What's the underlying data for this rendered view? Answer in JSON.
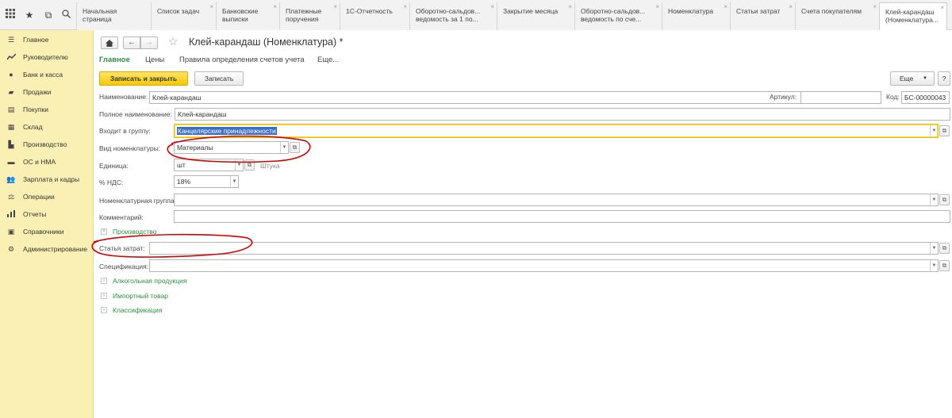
{
  "tabs": [
    {
      "label": "Начальная страница",
      "closable": false
    },
    {
      "label": "Список задач",
      "closable": true
    },
    {
      "label": "Банковские\nвыписки",
      "closable": true
    },
    {
      "label": "Платежные\nпоручения",
      "closable": true
    },
    {
      "label": "1С-Отчетность",
      "closable": true
    },
    {
      "label": "Оборотно-сальдов...\nведомость за 1 по...",
      "closable": true
    },
    {
      "label": "Закрытие месяца",
      "closable": true
    },
    {
      "label": "Оборотно-сальдов...\nведомость по сче...",
      "closable": true
    },
    {
      "label": "Номенклатура",
      "closable": true
    },
    {
      "label": "Статьи затрат",
      "closable": true
    },
    {
      "label": "Счета покупателям",
      "closable": true
    },
    {
      "label": "Клей-карандаш\n(Номенклатура...",
      "closable": true
    }
  ],
  "sidebar": {
    "items": [
      {
        "label": "Главное",
        "icon": "menu-lines-icon"
      },
      {
        "label": "Руководителю",
        "icon": "trend-chart-icon"
      },
      {
        "label": "Банк и касса",
        "icon": "coin-icon"
      },
      {
        "label": "Продажи",
        "icon": "cart-icon"
      },
      {
        "label": "Покупки",
        "icon": "basket-icon"
      },
      {
        "label": "Склад",
        "icon": "warehouse-icon"
      },
      {
        "label": "Производство",
        "icon": "factory-icon"
      },
      {
        "label": "ОС и НМА",
        "icon": "truck-icon"
      },
      {
        "label": "Зарплата и кадры",
        "icon": "people-icon"
      },
      {
        "label": "Операции",
        "icon": "operations-icon"
      },
      {
        "label": "Отчеты",
        "icon": "bar-chart-icon"
      },
      {
        "label": "Справочники",
        "icon": "book-icon"
      },
      {
        "label": "Администрирование",
        "icon": "gear-icon"
      }
    ]
  },
  "form": {
    "title": "Клей-карандаш (Номенклатура) *",
    "subtabs": [
      "Главное",
      "Цены",
      "Правила определения счетов учета",
      "Еще..."
    ],
    "buttons": {
      "save_close": "Записать и закрыть",
      "save": "Записать",
      "more": "Еще",
      "help": "?"
    },
    "fields": {
      "name_label": "Наименование:",
      "name_value": "Клей-карандаш",
      "article_label": "Артикул:",
      "article_value": "",
      "code_label": "Код:",
      "code_value": "БС-00000043",
      "fullname_label": "Полное наименование:",
      "fullname_value": "Клей-карандаш",
      "group_label": "Входит в группу:",
      "group_value": "Канцелярские принадлежности",
      "type_label": "Вид номенклатуры:",
      "type_value": "Материалы",
      "unit_label": "Единица:",
      "unit_value": "шт",
      "unit_hint": "Штука",
      "vat_label": "% НДС:",
      "vat_value": "18%",
      "nomgroup_label": "Номенклатурная группа:",
      "nomgroup_value": "",
      "comment_label": "Комментарий:",
      "comment_value": "",
      "cost_label": "Статья затрат:",
      "cost_value": "",
      "spec_label": "Спецификация:",
      "spec_value": ""
    },
    "sections": {
      "production": "Производство",
      "alcohol": "Алкогольная продукция",
      "import": "Импортный товар",
      "classification": "Классификация"
    }
  },
  "colors": {
    "sidebar_bg": "#fbf0b4",
    "accent_green": "#2f8f3f",
    "primary_button": "#f5c900",
    "annotation_red": "#d40000"
  }
}
